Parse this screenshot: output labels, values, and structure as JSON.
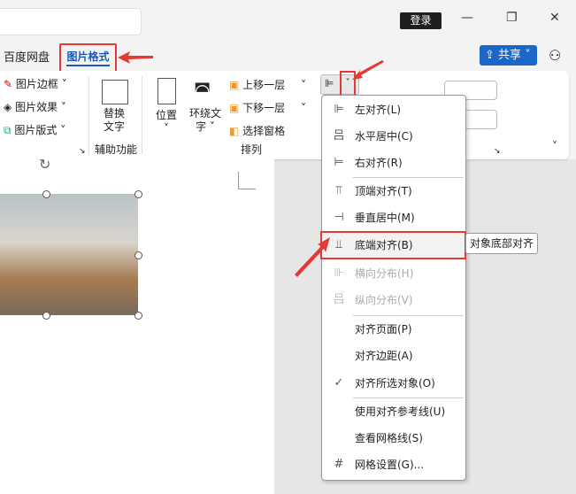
{
  "titlebar": {
    "login": "登录",
    "minimize": "—",
    "restore": "❐",
    "close": "✕"
  },
  "tabs": [
    {
      "label": "百度网盘"
    },
    {
      "label": "图片格式",
      "active": true
    }
  ],
  "share": {
    "label": "共享",
    "icon": "share-icon"
  },
  "ribbon": {
    "picture_styles": [
      "图片边框",
      "图片效果",
      "图片版式"
    ],
    "alt_text": [
      "替换",
      "文字"
    ],
    "group_accessibility": "辅助功能",
    "position": "位置",
    "wrap_text": [
      "环绕文",
      "字"
    ],
    "bring_forward": "上移一层",
    "send_backward": "下移一层",
    "selection_pane": "选择窗格",
    "group_arrange": "排列"
  },
  "align_menu": {
    "items": [
      {
        "label": "左对齐(L)",
        "icon": "align-left-icon"
      },
      {
        "label": "水平居中(C)",
        "icon": "align-center-icon"
      },
      {
        "label": "右对齐(R)",
        "icon": "align-right-icon"
      },
      {
        "label": "顶端对齐(T)",
        "icon": "align-top-icon"
      },
      {
        "label": "垂直居中(M)",
        "icon": "align-middle-icon"
      },
      {
        "label": "底端对齐(B)",
        "icon": "align-bottom-icon",
        "highlighted": true
      },
      {
        "label": "横向分布(H)",
        "icon": "distribute-horizontal-icon",
        "disabled": true
      },
      {
        "label": "纵向分布(V)",
        "icon": "distribute-vertical-icon",
        "disabled": true
      },
      {
        "label": "对齐页面(P)"
      },
      {
        "label": "对齐边距(A)"
      },
      {
        "label": "对齐所选对象(O)",
        "checked": true
      },
      {
        "label": "使用对齐参考线(U)"
      },
      {
        "label": "查看网格线(S)"
      },
      {
        "label": "网格设置(G)...",
        "icon": "grid-icon"
      }
    ]
  },
  "tooltip": "对象底部对齐",
  "colors": {
    "accent": "#1b57b5",
    "annotation": "#e53935",
    "share": "#1b66c9"
  }
}
